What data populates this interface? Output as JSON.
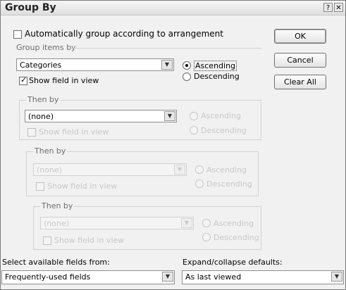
{
  "dialog": {
    "title": "Group By"
  },
  "titlebar": {
    "help_icon": "?",
    "close_icon": "✕"
  },
  "auto_group_label": "Automatically group according to arrangement",
  "buttons": {
    "ok": "OK",
    "cancel": "Cancel",
    "clear_all": "Clear All"
  },
  "group1": {
    "legend": "Group items by",
    "field": "Categories",
    "show_field": "Show field in view",
    "ascending": "Ascending",
    "descending": "Descending"
  },
  "group2": {
    "legend": "Then by",
    "field": "(none)",
    "show_field": "Show field in view",
    "ascending": "Ascending",
    "descending": "Descending"
  },
  "group3": {
    "legend": "Then by",
    "field": "(none)",
    "show_field": "Show field in view",
    "ascending": "Ascending",
    "descending": "Descending"
  },
  "group4": {
    "legend": "Then by",
    "field": "(none)",
    "show_field": "Show field in view",
    "ascending": "Ascending",
    "descending": "Descending"
  },
  "bottom": {
    "fields_label": "Select available fields from:",
    "fields_value": "Frequently-used fields",
    "expand_label": "Expand/collapse defaults:",
    "expand_value": "As last viewed"
  },
  "icons": {
    "dropdown": "▼",
    "check": "✓"
  }
}
